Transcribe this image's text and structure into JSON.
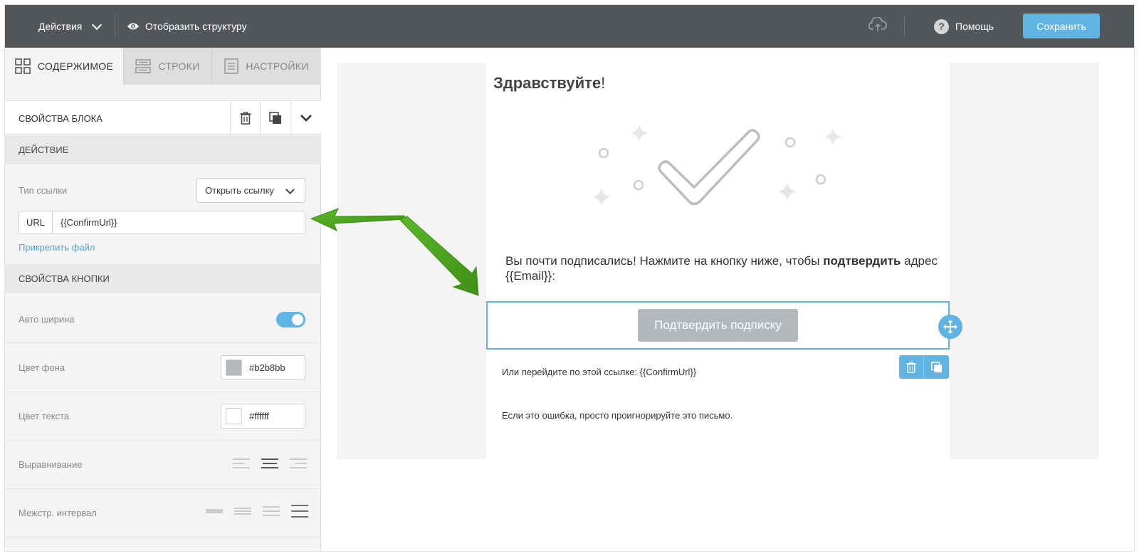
{
  "topbar": {
    "actions_label": "Действия",
    "structure_label": "Отобразить структуру",
    "help_label": "Помощь",
    "save_label": "Сохранить"
  },
  "tabs": [
    {
      "label": "СОДЕРЖИМОЕ",
      "icon": "grid-icon",
      "active": true
    },
    {
      "label": "СТРОКИ",
      "icon": "rows-icon",
      "active": false
    },
    {
      "label": "НАСТРОЙКИ",
      "icon": "settings-page-icon",
      "active": false
    }
  ],
  "block": {
    "title": "СВОЙСТВА БЛОКА"
  },
  "action": {
    "section_title": "ДЕЙСТВИЕ",
    "link_type_label": "Тип ссылки",
    "link_type_value": "Открыть ссылку",
    "url_prefix": "URL",
    "url_value": "{{ConfirmUrl}}",
    "attach_label": "Прикрепить файл"
  },
  "button_props": {
    "section_title": "СВОЙСТВА КНОПКИ",
    "auto_width_label": "Авто ширина",
    "auto_width_on": true,
    "bg_color_label": "Цвет фона",
    "bg_color_value": "#b2b8bb",
    "text_color_label": "Цвет текста",
    "text_color_value": "#ffffff",
    "align_label": "Выравнивание",
    "align_selected": "center",
    "line_height_label": "Межстр. интервал"
  },
  "email": {
    "greeting_bold": "Здравствуйте",
    "greeting_tail": "!",
    "body_text_pre": "Вы почти подписались! Нажмите на кнопку ниже, чтобы ",
    "body_text_bold": "подтвердить",
    "body_text_post": " адрес {{Email}}:",
    "button_label": "Подтвердить подписку",
    "link_text": "Или перейдите по этой ссылке: {{ConfirmUrl}}",
    "ignore_text": "Если это ошибка, просто проигнорируйте это письмо."
  },
  "colors": {
    "accent": "#5fb4e3",
    "topbar": "#545759",
    "arrow": "#4da51f"
  }
}
